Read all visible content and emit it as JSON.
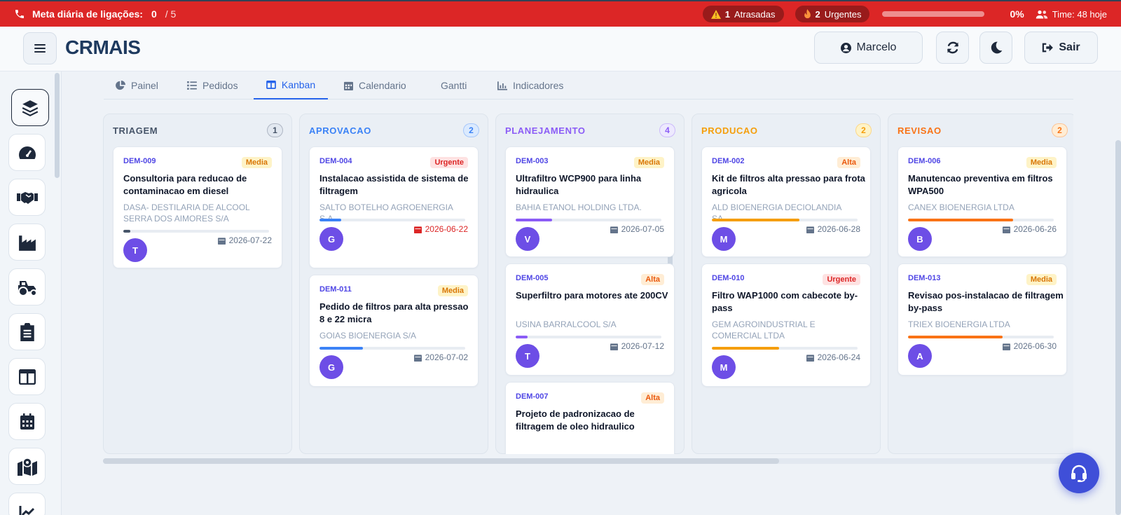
{
  "topbar": {
    "goal_label": "Meta diária de ligações:",
    "goal_done": "0",
    "goal_total": "/ 5",
    "late_count": "1",
    "late_label": "Atrasadas",
    "urgent_count": "2",
    "urgent_label": "Urgentes",
    "progress_pct": "0%",
    "progress_value": 0,
    "team_label": "Time: 48 hoje"
  },
  "header": {
    "brand": "CRMAIS",
    "user_name": "Marcelo",
    "logout_label": "Sair"
  },
  "tabs": [
    {
      "label": "Painel",
      "icon": "pie-chart-icon"
    },
    {
      "label": "Pedidos",
      "icon": "list-icon"
    },
    {
      "label": "Kanban",
      "icon": "columns-icon",
      "active": true
    },
    {
      "label": "Calendario",
      "icon": "calendar-icon"
    },
    {
      "label": "Gantti",
      "icon": ""
    },
    {
      "label": "Indicadores",
      "icon": "bar-chart-icon"
    }
  ],
  "sidebar": [
    {
      "icon": "layers-icon",
      "active": true
    },
    {
      "icon": "gauge-icon"
    },
    {
      "icon": "handshake-icon"
    },
    {
      "icon": "factory-icon"
    },
    {
      "icon": "tractor-icon"
    },
    {
      "icon": "clipboard-icon"
    },
    {
      "icon": "columns-icon"
    },
    {
      "icon": "calendar-icon"
    },
    {
      "icon": "map-pin-icon"
    },
    {
      "icon": "chart-line-icon"
    }
  ],
  "columns": [
    {
      "title": "TRIAGEM",
      "count": "1",
      "color": "#475569",
      "badge_bg": "#e2e8f0",
      "cards": [
        {
          "id": "DEM-009",
          "priority": "Media",
          "title": "Consultoria para reducao de contaminacao em diesel",
          "client": "DASA- DESTILARIA DE ALCOOL SERRA DOS AIMORES S/A",
          "progress": 0.05,
          "bar_color": "#475569",
          "avatar": "T",
          "date": "2026-07-22",
          "late": false
        }
      ]
    },
    {
      "title": "APROVACAO",
      "count": "2",
      "color": "#3b82f6",
      "badge_bg": "#dbeafe",
      "cards": [
        {
          "id": "DEM-004",
          "priority": "Urgente",
          "title": "Instalacao assistida de sistema de filtragem",
          "client": "SALTO BOTELHO AGROENERGIA S.A.",
          "progress": 0.15,
          "bar_color": "#3b82f6",
          "avatar": "G",
          "date": "2026-06-22",
          "late": true
        },
        {
          "id": "DEM-011",
          "priority": "Media",
          "title": "Pedido de filtros para alta pressao 8 e 22 micra",
          "client": "GOIAS BIOENERGIA S/A",
          "progress": 0.3,
          "bar_color": "#3b82f6",
          "avatar": "G",
          "date": "2026-07-02",
          "late": false
        }
      ]
    },
    {
      "title": "PLANEJAMENTO",
      "count": "4",
      "color": "#8b5cf6",
      "badge_bg": "#ede9fe",
      "cards": [
        {
          "id": "DEM-003",
          "priority": "Media",
          "title": "Ultrafiltro WCP900 para linha hidraulica",
          "client": "BAHIA ETANOL HOLDING LTDA.",
          "progress": 0.25,
          "bar_color": "#8b5cf6",
          "avatar": "V",
          "date": "2026-07-05",
          "late": false
        },
        {
          "id": "DEM-005",
          "priority": "Alta",
          "title": "Superfiltro para motores ate 200CV",
          "client": "USINA BARRALCOOL S/A",
          "progress": 0.08,
          "bar_color": "#8b5cf6",
          "avatar": "T",
          "date": "2026-07-12",
          "late": false
        },
        {
          "id": "DEM-007",
          "priority": "Alta",
          "title": "Projeto de padronizacao de filtragem de oleo hidraulico",
          "client": "",
          "progress": 0,
          "bar_color": "#8b5cf6",
          "avatar": "",
          "date": "",
          "late": false
        }
      ]
    },
    {
      "title": "PRODUCAO",
      "count": "2",
      "color": "#f59e0b",
      "badge_bg": "#fef3c7",
      "cards": [
        {
          "id": "DEM-002",
          "priority": "Alta",
          "title": "Kit de filtros alta pressao para frota agricola",
          "client": "ALD BIOENERGIA DECIOLANDIA SA",
          "progress": 0.6,
          "bar_color": "#f59e0b",
          "avatar": "M",
          "date": "2026-06-28",
          "late": false
        },
        {
          "id": "DEM-010",
          "priority": "Urgente",
          "title": "Filtro WAP1000 com cabecote by-pass",
          "client": "GEM AGROINDUSTRIAL E COMERCIAL LTDA",
          "progress": 0.46,
          "bar_color": "#f59e0b",
          "avatar": "M",
          "date": "2026-06-24",
          "late": false
        }
      ]
    },
    {
      "title": "REVISAO",
      "count": "2",
      "color": "#f97316",
      "badge_bg": "#ffedd5",
      "cards": [
        {
          "id": "DEM-006",
          "priority": "Media",
          "title": "Manutencao preventiva em filtros WPA500",
          "client": "CANEX BIOENERGIA LTDA",
          "progress": 0.72,
          "bar_color": "#f97316",
          "avatar": "B",
          "date": "2026-06-26",
          "late": false
        },
        {
          "id": "DEM-013",
          "priority": "Media",
          "title": "Revisao pos-instalacao de filtragem by-pass",
          "client": "TRIEX BIOENERGIA LTDA",
          "progress": 0.65,
          "bar_color": "#f97316",
          "avatar": "A",
          "date": "2026-06-30",
          "late": false
        }
      ]
    }
  ]
}
